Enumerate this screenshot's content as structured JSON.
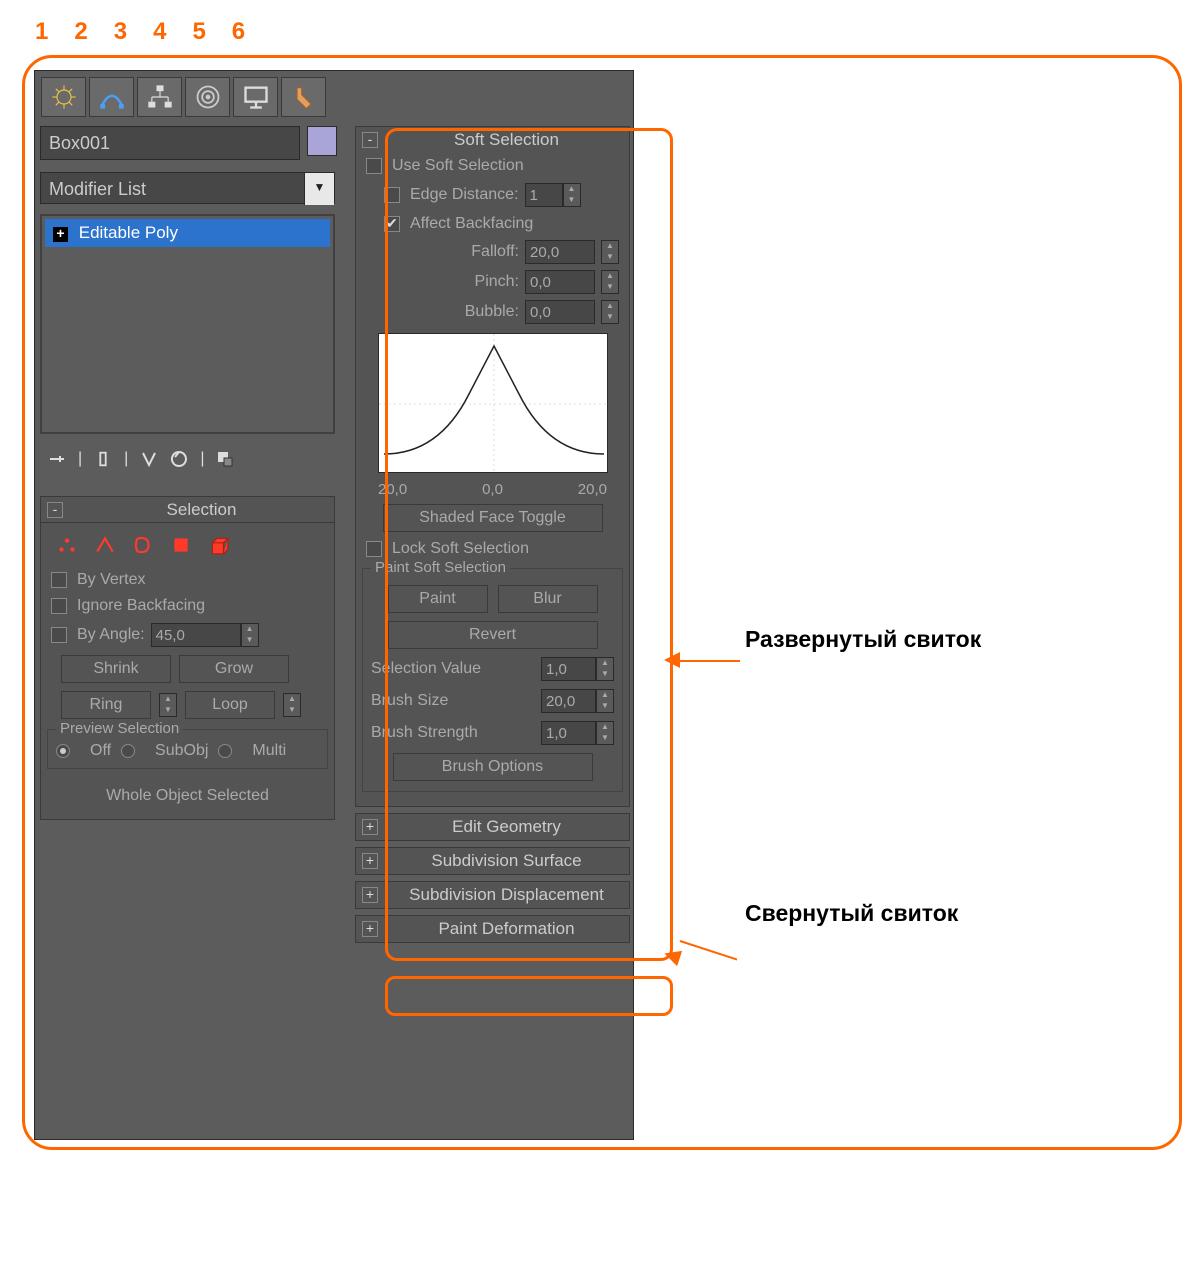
{
  "topnums": [
    "1",
    "2",
    "3",
    "4",
    "5",
    "6"
  ],
  "left": {
    "object_name": "Box001",
    "modifier_list": "Modifier List",
    "stack_item": "Editable Poly",
    "stack_plus": "+"
  },
  "selection": {
    "title": "Selection",
    "toggle": "-",
    "by_vertex": "By Vertex",
    "ignore_backfacing": "Ignore Backfacing",
    "by_angle": "By Angle:",
    "by_angle_val": "45,0",
    "shrink": "Shrink",
    "grow": "Grow",
    "ring": "Ring",
    "loop": "Loop",
    "preview_title": "Preview Selection",
    "off": "Off",
    "subobj": "SubObj",
    "multi": "Multi",
    "whole_obj": "Whole Object Selected"
  },
  "soft": {
    "title": "Soft Selection",
    "toggle": "-",
    "use_soft": "Use Soft Selection",
    "edge_distance": "Edge Distance:",
    "edge_distance_val": "1",
    "affect_backfacing": "Affect Backfacing",
    "falloff": "Falloff:",
    "falloff_val": "20,0",
    "pinch": "Pinch:",
    "pinch_val": "0,0",
    "bubble": "Bubble:",
    "bubble_val": "0,0",
    "graph_labels": [
      "20,0",
      "0,0",
      "20,0"
    ],
    "shaded_face": "Shaded Face Toggle",
    "lock_soft": "Lock Soft Selection",
    "paint_group": "Paint Soft Selection",
    "paint": "Paint",
    "blur": "Blur",
    "revert": "Revert",
    "sel_value": "Selection Value",
    "sel_value_val": "1,0",
    "brush_size": "Brush Size",
    "brush_size_val": "20,0",
    "brush_strength": "Brush Strength",
    "brush_strength_val": "1,0",
    "brush_options": "Brush Options"
  },
  "collapsed": {
    "edit_geometry": "Edit Geometry",
    "subdiv_surface": "Subdivision Surface",
    "subdiv_disp": "Subdivision Displacement",
    "paint_def": "Paint Deformation",
    "plus": "+"
  },
  "callouts": {
    "expanded": "Развернутый свиток",
    "collapsed": "Свернутый свиток"
  }
}
